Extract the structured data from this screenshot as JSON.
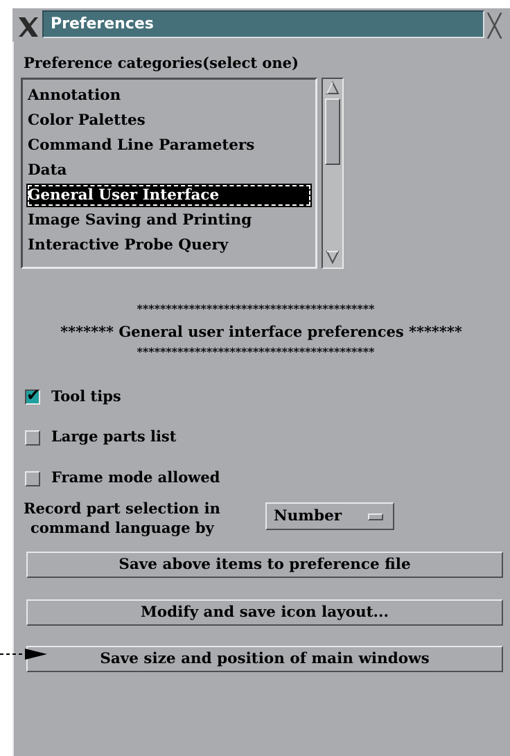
{
  "window": {
    "title": "Preferences",
    "close_glyph": "╳",
    "logo_icon": "x-window-logo-icon"
  },
  "categories": {
    "label": "Preference categories(select one)",
    "items": [
      {
        "label": "Annotation",
        "selected": false
      },
      {
        "label": "Color Palettes",
        "selected": false
      },
      {
        "label": "Command Line Parameters",
        "selected": false
      },
      {
        "label": "Data",
        "selected": false
      },
      {
        "label": "General User Interface",
        "selected": true
      },
      {
        "label": "Image Saving and Printing",
        "selected": false
      },
      {
        "label": "Interactive Probe Query",
        "selected": false
      }
    ]
  },
  "banner": {
    "stars_top": "*****************************************",
    "heading": "******* General user interface preferences *******",
    "stars_bottom": "*****************************************"
  },
  "options": {
    "tool_tips": {
      "label": "Tool tips",
      "checked": true
    },
    "large_parts_list": {
      "label": "Large parts list",
      "checked": false
    },
    "frame_mode": {
      "label": "Frame mode allowed",
      "checked": false
    }
  },
  "record": {
    "label_line1": "Record part selection in",
    "label_line2": "command language by",
    "selected_value": "Number"
  },
  "buttons": {
    "save_prefs": "Save above items to preference file",
    "modify_icons": "Modify and save icon layout...",
    "save_size": "Save size and position of main windows"
  },
  "colors": {
    "background": "#a9abaf",
    "title_bar": "#45707a",
    "checked": "#20a0a0"
  }
}
